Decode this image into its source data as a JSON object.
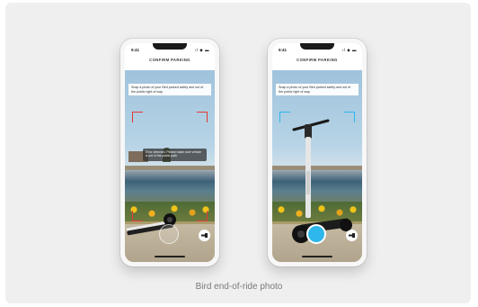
{
  "caption": "Bird end-of-ride photo",
  "colors": {
    "error_corner": "#e53935",
    "ok_corner": "#2db7ea",
    "shutter_active": "#2db7ea"
  },
  "phones": [
    {
      "status_time": "9:41",
      "status_icons": "ıl ◆ ▬",
      "title": "CONFIRM PARKING",
      "instruction": "Snap a photo of your Bird parked safely and out of the public right of way.",
      "toast": "Error detected. Please make sure vehicle is out of the public path.",
      "shutter_state": "disabled",
      "flash_icon": "flashlight-icon"
    },
    {
      "status_time": "9:41",
      "status_icons": "ıl ◆ ▬",
      "title": "CONFIRM PARKING",
      "instruction": "Snap a photo of your Bird parked safely and out of the public right of way.",
      "shutter_state": "active",
      "flash_icon": "flashlight-icon"
    }
  ]
}
